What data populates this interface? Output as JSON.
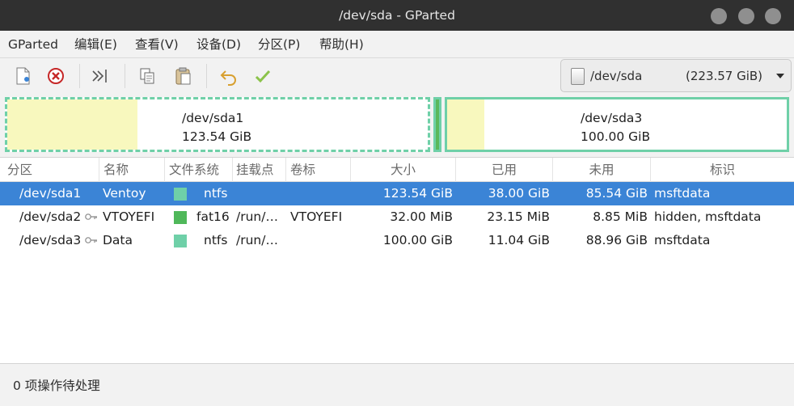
{
  "window": {
    "title": "/dev/sda - GParted"
  },
  "menu": [
    "GParted",
    "编辑(E)",
    "查看(V)",
    "设备(D)",
    "分区(P)",
    "帮助(H)"
  ],
  "toolbar": {
    "icons": [
      "new-partition-icon",
      "delete-partition-icon",
      "resize-move-icon",
      "copy-icon",
      "paste-icon",
      "undo-icon",
      "apply-icon"
    ]
  },
  "device": {
    "name": "/dev/sda",
    "size": "(223.57 GiB)"
  },
  "graph": {
    "p1": {
      "name": "/dev/sda1",
      "size": "123.54 GiB",
      "used_fraction": 0.31
    },
    "p3": {
      "name": "/dev/sda3",
      "size": "100.00 GiB",
      "used_fraction": 0.11
    }
  },
  "columns": [
    "分区",
    "名称",
    "文件系统",
    "挂载点",
    "卷标",
    "大小",
    "已用",
    "未用",
    "标识"
  ],
  "rows": [
    {
      "partition": "/dev/sda1",
      "name": "Ventoy",
      "fs": "ntfs",
      "fs_color": "#6fd0a8",
      "mount": "",
      "label": "",
      "size": "123.54 GiB",
      "used": "38.00 GiB",
      "unused": "85.54 GiB",
      "flags": "msftdata",
      "mounted": false
    },
    {
      "partition": "/dev/sda2",
      "name": "VTOYEFI",
      "fs": "fat16",
      "fs_color": "#4fb85a",
      "mount": "/run/…",
      "label": "VTOYEFI",
      "size": "32.00 MiB",
      "used": "23.15 MiB",
      "unused": "8.85 MiB",
      "flags": "hidden, msftdata",
      "mounted": true
    },
    {
      "partition": "/dev/sda3",
      "name": "Data",
      "fs": "ntfs",
      "fs_color": "#6fd0a8",
      "mount": "/run/…",
      "label": "",
      "size": "100.00 GiB",
      "used": "11.04 GiB",
      "unused": "88.96 GiB",
      "flags": "msftdata",
      "mounted": true
    }
  ],
  "status": {
    "text": "0 项操作待处理"
  },
  "colors": {
    "selection": "#3b84d6",
    "ntfs": "#6fd0a8",
    "fat16": "#4fb85a",
    "used": "#f8f8be"
  }
}
